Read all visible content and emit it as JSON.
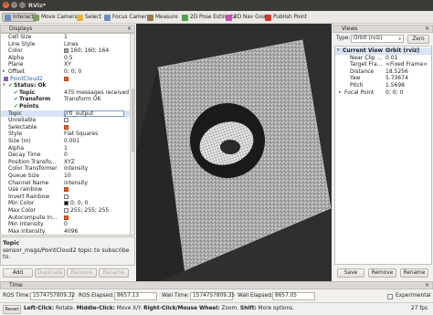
{
  "window": {
    "title": "RViz*"
  },
  "toolbar": {
    "items": [
      {
        "label": "Interact",
        "icon": "interact-icon",
        "color": "#6c8fbf",
        "active": true
      },
      {
        "label": "Move Camera",
        "icon": "move-camera-icon",
        "color": "#7c9f5c"
      },
      {
        "label": "Select",
        "icon": "select-icon",
        "color": "#e8b23a"
      },
      {
        "label": "Focus Camera",
        "icon": "focus-camera-icon",
        "color": "#6c8fbf"
      },
      {
        "label": "Measure",
        "icon": "measure-icon",
        "color": "#9a7a4e"
      },
      {
        "label": "2D Pose Estimate",
        "icon": "pose-estimate-icon",
        "color": "#4ca34c"
      },
      {
        "label": "2D Nav Goal",
        "icon": "nav-goal-icon",
        "color": "#c84fb4"
      },
      {
        "label": "Publish Point",
        "icon": "publish-point-icon",
        "color": "#d03a2f"
      }
    ]
  },
  "displays": {
    "title": "Displays",
    "rows": [
      {
        "k": "Cell Size",
        "v": "1",
        "ind": 8
      },
      {
        "k": "Line Style",
        "v": "Lines",
        "ind": 8
      },
      {
        "k": "Color",
        "v": "160; 160; 164",
        "ind": 8,
        "swatch": "#a0a0a4"
      },
      {
        "k": "Alpha",
        "v": "0.5",
        "ind": 8
      },
      {
        "k": "Plane",
        "v": "XY",
        "ind": 8
      },
      {
        "k": "Offset",
        "v": "0; 0; 0",
        "ind": 8,
        "arrow": "▸"
      },
      {
        "k": "PointCloud2",
        "v": "",
        "ind": 3,
        "arrow": "▾",
        "check": true,
        "blue": true,
        "icon": true
      },
      {
        "k": "Status: Ok",
        "v": "",
        "ind": 8,
        "arrow": "▾",
        "bold": true,
        "ok": true
      },
      {
        "k": "Topic",
        "v": "475 messages received",
        "ind": 14,
        "bold": true,
        "ok": true
      },
      {
        "k": "Transform",
        "v": "Transform OK",
        "ind": 14,
        "bold": true,
        "ok": true
      },
      {
        "k": "Points",
        "v": "",
        "ind": 14,
        "bold": true,
        "ok": true
      },
      {
        "k": "Topic",
        "v": "/rtl_output",
        "ind": 8,
        "selected": true
      },
      {
        "k": "Unreliable",
        "v": "",
        "ind": 8,
        "emptybox": true
      },
      {
        "k": "Selectable",
        "v": "",
        "ind": 8,
        "check": true
      },
      {
        "k": "Style",
        "v": "Flat Squares",
        "ind": 8
      },
      {
        "k": "Size (m)",
        "v": "0.001",
        "ind": 8
      },
      {
        "k": "Alpha",
        "v": "1",
        "ind": 8
      },
      {
        "k": "Decay Time",
        "v": "0",
        "ind": 8
      },
      {
        "k": "Position Transfo...",
        "v": "XYZ",
        "ind": 8
      },
      {
        "k": "Color Transformer",
        "v": "Intensity",
        "ind": 8
      },
      {
        "k": "Queue Size",
        "v": "10",
        "ind": 8
      },
      {
        "k": "Channel Name",
        "v": "intensity",
        "ind": 8
      },
      {
        "k": "Use rainbow",
        "v": "",
        "ind": 8,
        "check": true
      },
      {
        "k": "Invert Rainbow",
        "v": "",
        "ind": 8,
        "emptybox": true
      },
      {
        "k": "Min Color",
        "v": "0; 0; 0",
        "ind": 8,
        "swatch": "#000000"
      },
      {
        "k": "Max Color",
        "v": "255; 255; 255",
        "ind": 8,
        "swatch": "#ffffff"
      },
      {
        "k": "Autocompute In...",
        "v": "",
        "ind": 8,
        "check": true
      },
      {
        "k": "Min Intensity",
        "v": "0",
        "ind": 8
      },
      {
        "k": "Max Intensity",
        "v": "4096",
        "ind": 8
      }
    ],
    "help_title": "Topic",
    "help_text": "sensor_msgs/PointCloud2 topic to subscribe to.",
    "buttons": {
      "add": "Add",
      "duplicate": "Duplicate",
      "remove": "Remove",
      "rename": "Rename"
    }
  },
  "views": {
    "title": "Views",
    "type_label": "Type:",
    "type_value": "Orbit (rviz)",
    "zero": "Zero",
    "rows": [
      {
        "k": "Current View",
        "v": "Orbit (rviz)",
        "ind": 2,
        "arrow": "▾",
        "header": true
      },
      {
        "k": "Near Clip ...",
        "v": "0.01",
        "ind": 10
      },
      {
        "k": "Target Fra...",
        "v": "<Fixed Frame>",
        "ind": 10
      },
      {
        "k": "Distance",
        "v": "18.5256",
        "ind": 10
      },
      {
        "k": "Yaw",
        "v": "5.73674",
        "ind": 10
      },
      {
        "k": "Pitch",
        "v": "1.5698",
        "ind": 10
      },
      {
        "k": "Focal Point",
        "v": "0; 0; 0",
        "ind": 4,
        "arrow": "▸"
      }
    ],
    "buttons": {
      "save": "Save",
      "remove": "Remove",
      "rename": "Rename"
    }
  },
  "time": {
    "title": "Time",
    "ros_time_label": "ROS Time:",
    "ros_time": "1574757809.32",
    "ros_elapsed_label": "ROS Elapsed:",
    "ros_elapsed": "8657.13",
    "wall_time_label": "Wall Time:",
    "wall_time": "1574757809.35",
    "wall_elapsed_label": "Wall Elapsed:",
    "wall_elapsed": "8657.05",
    "experimental": "Experimental",
    "reset": "Reset"
  },
  "status": {
    "hint": "Left-Click: Rotate. Middle-Click: Move X/Y. Right-Click/Mouse Wheel: Zoom. Shift: More options.",
    "fps": "27 fps"
  }
}
